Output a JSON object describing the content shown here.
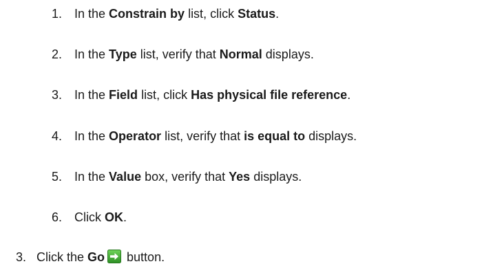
{
  "sub_steps": [
    {
      "number": "1.",
      "pre": "In the ",
      "bold1": "Constrain by",
      "mid": " list, click ",
      "bold2": "Status",
      "post": "."
    },
    {
      "number": "2.",
      "pre": "In the ",
      "bold1": "Type",
      "mid": " list, verify that ",
      "bold2": "Normal",
      "post": " displays."
    },
    {
      "number": "3.",
      "pre": "In the ",
      "bold1": "Field",
      "mid": " list, click ",
      "bold2": "Has physical file reference",
      "post": "."
    },
    {
      "number": "4.",
      "pre": "In the ",
      "bold1": "Operator",
      "mid": " list, verify that ",
      "bold2": "is equal to",
      "post": " displays."
    },
    {
      "number": "5.",
      "pre": "In the ",
      "bold1": "Value",
      "mid": " box, verify that ",
      "bold2": "Yes",
      "post": " displays."
    },
    {
      "number": "6.",
      "pre": "Click ",
      "bold1": "OK",
      "post": "."
    }
  ],
  "main_step": {
    "number": "3.",
    "pre": "Click the ",
    "bold": "Go",
    "post": " button.",
    "icon": "go-arrow-icon",
    "icon_color": "#3aa82f"
  }
}
